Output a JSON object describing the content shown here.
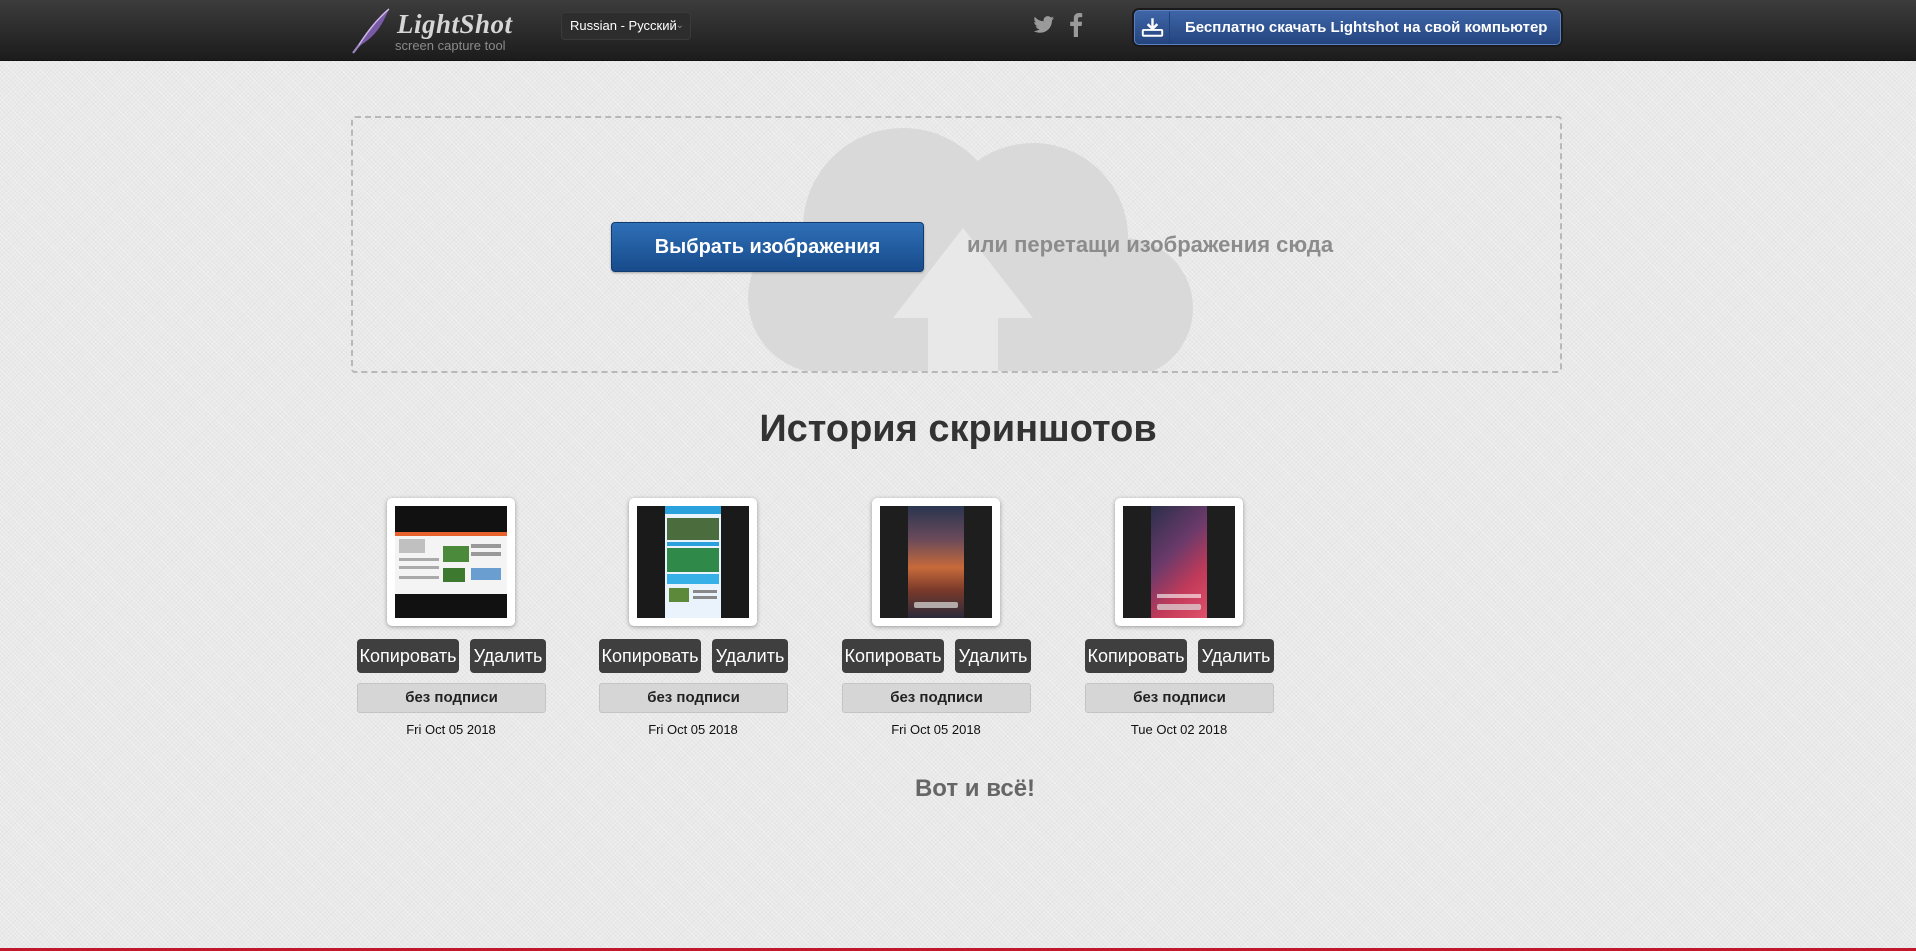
{
  "header": {
    "logo_name": "LightShot",
    "logo_tagline": "screen capture tool",
    "language": "Russian - Русский",
    "download_label": "Бесплатно скачать Lightshot на свой компьютер",
    "icons": [
      "feather-logo-icon",
      "twitter-icon",
      "facebook-icon",
      "download-icon"
    ]
  },
  "upload": {
    "select_label": "Выбрать изображения",
    "drop_hint": "или перетащи изображения сюда",
    "background_icon": "cloud-upload-icon"
  },
  "history": {
    "title": "История скриншотов",
    "items": [
      {
        "copy_label": "Копировать",
        "delete_label": "Удалить",
        "caption": "без подписи",
        "date": "Fri Oct 05 2018"
      },
      {
        "copy_label": "Копировать",
        "delete_label": "Удалить",
        "caption": "без подписи",
        "date": "Fri Oct 05 2018"
      },
      {
        "copy_label": "Копировать",
        "delete_label": "Удалить",
        "caption": "без подписи",
        "date": "Fri Oct 05 2018"
      },
      {
        "copy_label": "Копировать",
        "delete_label": "Удалить",
        "caption": "без подписи",
        "date": "Tue Oct 02 2018"
      }
    ],
    "end_text": "Вот и всё!"
  },
  "colors": {
    "header_bg": "#2a2a2a",
    "accent_blue": "#1f5ea2",
    "dark_button": "#3f3f3f",
    "bottom_accent": "#c0182c"
  }
}
